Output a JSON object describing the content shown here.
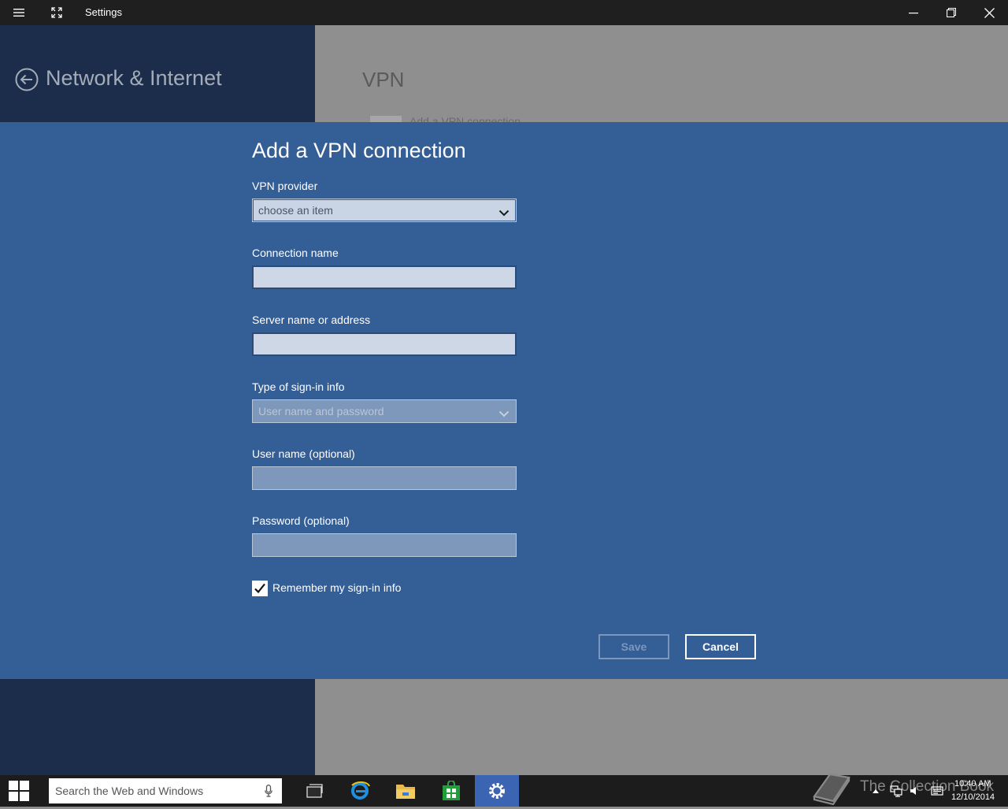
{
  "window": {
    "title": "Settings"
  },
  "background": {
    "back_title": "Network & Internet",
    "pane_title": "VPN",
    "pane_item": "Add a VPN connection"
  },
  "dialog": {
    "title": "Add a VPN connection",
    "provider_label": "VPN provider",
    "provider_value": "choose an item",
    "connection_name_label": "Connection name",
    "connection_name_value": "",
    "server_label": "Server name or address",
    "server_value": "",
    "signin_type_label": "Type of sign-in info",
    "signin_type_value": "User name and password",
    "username_label": "User name (optional)",
    "username_value": "",
    "password_label": "Password (optional)",
    "password_value": "",
    "remember_label": "Remember my sign-in info",
    "remember_checked": true,
    "save_label": "Save",
    "cancel_label": "Cancel"
  },
  "taskbar": {
    "search_placeholder": "Search the Web and Windows",
    "watermark": "The Collection Book",
    "time": "10:40 AM",
    "date": "12/10/2014",
    "apps": [
      "task-view-icon",
      "internet-explorer-icon",
      "file-explorer-icon",
      "store-icon",
      "settings-icon"
    ]
  },
  "colors": {
    "dialog_bg": "#345e96",
    "left_pane_bg": "#1b2d4b",
    "right_pane_bg": "#8f8f8f",
    "titlebar_bg": "#1f1f1f",
    "taskbar_bg": "#1c1c1c",
    "active_app": "#3b64b3"
  }
}
